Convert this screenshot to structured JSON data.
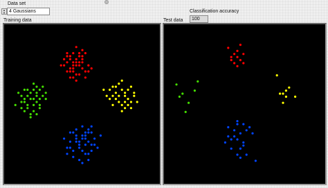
{
  "dataset": {
    "label": "Data set",
    "value": "4 Gaussians"
  },
  "accuracy": {
    "label": "Classification accuracy",
    "value": "100"
  },
  "training": {
    "label": "Training data"
  },
  "test": {
    "label": "Test data"
  },
  "colors": {
    "red": "#ff0000",
    "green": "#44dd00",
    "yellow": "#ffff00",
    "blue": "#0044ff"
  },
  "chart_data": [
    {
      "type": "scatter",
      "title": "Training data",
      "series": [
        {
          "name": "",
          "color": "#ff0000",
          "x": [
            -0.3,
            -0.5,
            -0.2,
            0.0,
            -0.4,
            -0.1,
            0.1,
            -0.2,
            -0.6,
            -0.3,
            0.0,
            -0.5,
            -0.1,
            0.2,
            -0.4,
            -0.3,
            -0.2,
            0.0,
            -0.6,
            0.1,
            -0.3,
            -0.1,
            -0.4,
            -0.2,
            0.0,
            -0.5,
            -0.3,
            0.1,
            -0.2,
            -0.4,
            -0.1,
            0.2,
            -0.7,
            -0.3,
            0.0,
            -0.2,
            -0.4,
            0.3,
            -0.5,
            -0.1
          ],
          "y": [
            1.2,
            1.5,
            0.9,
            1.3,
            1.1,
            1.6,
            1.0,
            1.4,
            1.2,
            0.8,
            1.7,
            1.0,
            1.3,
            1.2,
            1.5,
            1.1,
            0.7,
            1.4,
            1.4,
            1.6,
            1.3,
            0.9,
            1.0,
            1.8,
            1.1,
            1.3,
            1.6,
            0.8,
            1.2,
            1.4,
            1.5,
            1.0,
            1.2,
            1.0,
            1.5,
            1.3,
            0.8,
            1.1,
            1.6,
            1.2
          ]
        },
        {
          "name": "",
          "color": "#44dd00",
          "x": [
            -1.6,
            -1.9,
            -1.4,
            -1.7,
            -2.0,
            -1.5,
            -1.8,
            -1.3,
            -1.6,
            -2.1,
            -1.4,
            -1.7,
            -1.9,
            -1.5,
            -1.2,
            -1.8,
            -1.6,
            -2.2,
            -1.4,
            -1.7,
            -1.5,
            -1.9,
            -1.3,
            -1.8,
            -1.6,
            -2.0,
            -1.4,
            -1.7,
            -1.5,
            -1.9,
            -1.2,
            -1.6,
            -2.0,
            -1.8,
            -1.5
          ],
          "y": [
            0.1,
            0.4,
            -0.1,
            0.3,
            0.0,
            0.5,
            -0.2,
            0.2,
            -0.3,
            0.3,
            0.4,
            -0.4,
            0.1,
            0.0,
            0.3,
            0.2,
            0.6,
            -0.1,
            -0.2,
            0.1,
            0.3,
            -0.3,
            0.5,
            0.4,
            -0.1,
            0.2,
            0.1,
            -0.5,
            0.2,
            0.0,
            0.1,
            0.4,
            -0.2,
            -0.1,
            -0.4
          ]
        },
        {
          "name": "",
          "color": "#ffff00",
          "x": [
            1.2,
            1.5,
            0.9,
            1.3,
            1.7,
            1.0,
            1.4,
            1.1,
            1.6,
            0.8,
            1.2,
            1.5,
            1.3,
            1.8,
            1.0,
            1.4,
            1.1,
            1.6,
            1.3,
            0.9,
            1.5,
            1.2,
            1.7,
            1.4,
            1.0,
            1.3,
            1.6,
            0.7,
            1.4,
            1.1
          ],
          "y": [
            0.2,
            0.4,
            0.1,
            -0.1,
            0.3,
            0.5,
            0.0,
            0.3,
            -0.2,
            0.2,
            0.6,
            0.1,
            0.4,
            0.0,
            -0.1,
            0.2,
            0.1,
            0.5,
            -0.3,
            0.4,
            -0.1,
            0.0,
            0.2,
            0.3,
            0.2,
            0.7,
            0.0,
            0.4,
            -0.2,
            0.5
          ]
        },
        {
          "name": "",
          "color": "#0044ff",
          "x": [
            0.0,
            -0.3,
            0.3,
            -0.1,
            0.2,
            -0.4,
            0.1,
            -0.2,
            0.4,
            0.0,
            -0.5,
            0.2,
            -0.1,
            0.3,
            -0.3,
            0.1,
            -0.2,
            0.5,
            0.0,
            -0.4,
            0.2,
            -0.1,
            0.3,
            -0.6,
            0.1,
            0.0,
            -0.3,
            0.4,
            -0.2,
            0.1,
            0.6,
            -0.1,
            0.2,
            -0.4,
            0.0,
            0.3,
            -0.2,
            0.1,
            -0.5,
            0.2
          ],
          "y": [
            -1.2,
            -1.0,
            -1.4,
            -1.5,
            -0.9,
            -1.3,
            -1.7,
            -1.1,
            -1.2,
            -0.8,
            -1.5,
            -1.3,
            -1.9,
            -1.0,
            -1.6,
            -1.4,
            -1.2,
            -1.5,
            -1.1,
            -1.0,
            -1.7,
            -1.3,
            -0.8,
            -1.2,
            -1.0,
            -1.6,
            -1.8,
            -1.4,
            -0.9,
            -1.2,
            -1.1,
            -1.4,
            -1.9,
            -1.5,
            -2.0,
            -1.6,
            -1.3,
            -1.1,
            -1.7,
            -1.0
          ]
        }
      ]
    },
    {
      "type": "scatter",
      "title": "Test data",
      "series": [
        {
          "name": "",
          "color": "#ff0000",
          "x": [
            -0.2,
            0.0,
            -0.1,
            0.1,
            -0.3,
            0.0,
            0.2,
            -0.1,
            0.1,
            0.2,
            -0.2,
            0.0
          ],
          "y": [
            1.2,
            1.4,
            1.0,
            1.1,
            1.5,
            0.9,
            1.3,
            1.3,
            1.6,
            1.0,
            1.1,
            1.2
          ]
        },
        {
          "name": "",
          "color": "#44dd00",
          "x": [
            -1.8,
            -1.6,
            -2.0,
            -1.4,
            -1.9,
            -1.3,
            -1.7
          ],
          "y": [
            0.0,
            -0.3,
            0.3,
            0.1,
            -0.1,
            0.4,
            -0.6
          ]
        },
        {
          "name": "",
          "color": "#ffff00",
          "x": [
            1.4,
            1.6,
            1.7,
            1.5,
            1.3,
            1.9,
            1.6,
            1.5
          ],
          "y": [
            0.0,
            -0.1,
            0.2,
            -0.3,
            0.6,
            -0.1,
            0.1,
            0.0
          ]
        },
        {
          "name": "",
          "color": "#0044ff",
          "x": [
            0.0,
            -0.3,
            0.2,
            0.1,
            -0.1,
            0.3,
            0.0,
            -0.4,
            0.2,
            -0.2,
            0.4,
            0.1,
            -0.1,
            0.3,
            0.0,
            -0.3,
            0.5,
            0.1,
            -0.2,
            0.2,
            0.6,
            0.0
          ],
          "y": [
            -0.9,
            -1.1,
            -1.0,
            -1.3,
            -1.4,
            -1.2,
            -1.5,
            -1.6,
            -1.6,
            -1.8,
            -1.1,
            -1.8,
            -1.2,
            -2.0,
            -1.0,
            -1.4,
            -1.3,
            -2.1,
            -1.5,
            -1.7,
            -2.2,
            -2.0
          ]
        }
      ]
    }
  ]
}
